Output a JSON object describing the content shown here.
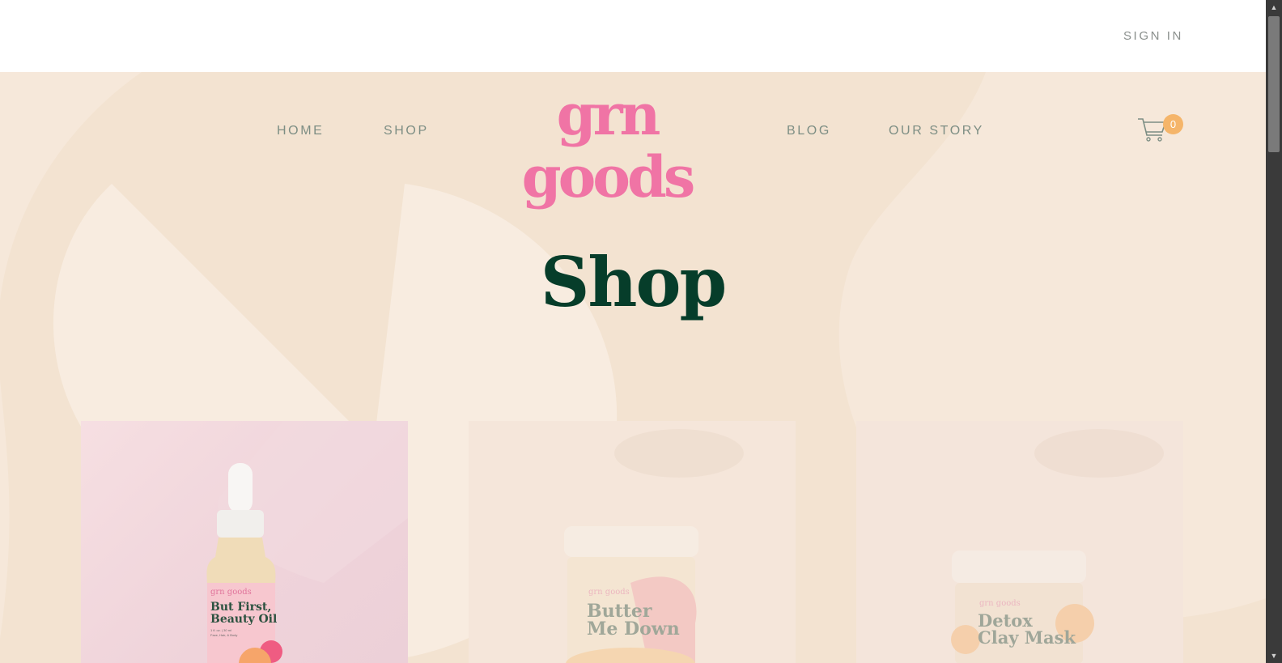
{
  "header": {
    "signin_label": "SIGN IN"
  },
  "nav": {
    "home": "HOME",
    "shop": "SHOP",
    "logo": "grn goods",
    "blog": "BLOG",
    "our_story": "OUR STORY",
    "cart_count": "0",
    "cart_icon": "cart-icon"
  },
  "page": {
    "title": "Shop"
  },
  "products": [
    {
      "brand": "grn goods",
      "name_line1": "But First,",
      "name_line2": "Beauty Oil",
      "detail_line1": "1 fl. oz. | 30 ml",
      "detail_line2": "Face, Hair, & Body"
    },
    {
      "brand": "grn goods",
      "name_line1": "Butter",
      "name_line2": "Me Down"
    },
    {
      "brand": "grn goods",
      "name_line1": "Detox",
      "name_line2": "Clay Mask"
    }
  ],
  "colors": {
    "brand_pink": "#f074a5",
    "title_green": "#063d2a",
    "nav_gray_green": "#7d8e84",
    "cart_badge": "#f5b56a",
    "hero_bg": "#f3e3d1"
  },
  "scrollbar": {
    "up_icon": "scroll-up-arrow-icon",
    "down_icon": "scroll-down-arrow-icon"
  }
}
